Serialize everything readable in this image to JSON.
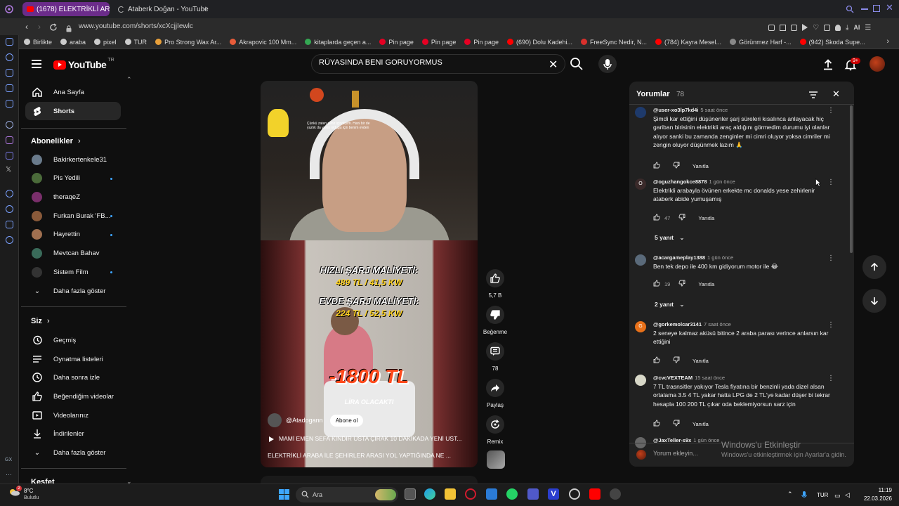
{
  "browser": {
    "tabs": [
      {
        "label": "(1678) ELEKTRİKLİ ARA"
      },
      {
        "label": "Ataberk Doğan - YouTube"
      }
    ],
    "url": "www.youtube.com/shorts/xcXcjjIewlc",
    "bookmarks": [
      {
        "label": "Birlikte",
        "color": "#cccccc"
      },
      {
        "label": "araba",
        "color": "#cccccc"
      },
      {
        "label": "pixel",
        "color": "#cccccc"
      },
      {
        "label": "TUR",
        "color": "#cccccc"
      },
      {
        "label": "Pro Strong Wax Ar...",
        "color": "#e8a03a"
      },
      {
        "label": "Akrapovic 100 Mm...",
        "color": "#e85c3a"
      },
      {
        "label": "kitaplarda geçen a...",
        "color": "#34a853"
      },
      {
        "label": "Pin page",
        "color": "#e60023"
      },
      {
        "label": "Pin page",
        "color": "#e60023"
      },
      {
        "label": "Pin page",
        "color": "#e60023"
      },
      {
        "label": "(690) Dolu Kadehi...",
        "color": "#ff0000"
      },
      {
        "label": "FreeSync Nedir, N...",
        "color": "#d9302c"
      },
      {
        "label": "(784) Kayra Mesel...",
        "color": "#ff0000"
      },
      {
        "label": "Görünmez Harf -...",
        "color": "#888888"
      },
      {
        "label": "(942) Skoda Supe...",
        "color": "#ff0000"
      }
    ],
    "extension_label": "AI"
  },
  "header": {
    "logo_text": "YouTube",
    "logo_region": "TR",
    "search_value": "RÜYASINDA BENI GORUYORMUS",
    "notif_badge": "9+"
  },
  "sidebar": {
    "main": [
      {
        "label": "Ana Sayfa"
      },
      {
        "label": "Shorts"
      }
    ],
    "subscriptions_title": "Abonelikler",
    "subscriptions": [
      {
        "label": "Bakirkertenkele31",
        "color": "#6a7b8c",
        "dot": false
      },
      {
        "label": "Pis Yedili",
        "color": "#4b6b3a",
        "dot": true
      },
      {
        "label": "theraqeZ",
        "color": "#7a2f6b",
        "dot": false
      },
      {
        "label": "Furkan Burak 'FB...",
        "color": "#8a5a3a",
        "dot": true
      },
      {
        "label": "Hayrettin",
        "color": "#a07050",
        "dot": true
      },
      {
        "label": "Mevtcan Bahav",
        "color": "#3a6b5a",
        "dot": false
      },
      {
        "label": "Sistem Film",
        "color": "#333333",
        "dot": true
      }
    ],
    "show_more": "Daha fazla göster",
    "you_title": "Siz",
    "you_items": [
      {
        "label": "Geçmiş"
      },
      {
        "label": "Oynatma listeleri"
      },
      {
        "label": "Daha sonra izle"
      },
      {
        "label": "Beğendiğim videolar"
      },
      {
        "label": "Videolarınız"
      },
      {
        "label": "İndirilenler"
      }
    ],
    "show_more_2": "Daha fazla göster",
    "explore_title": "Keşfet"
  },
  "video": {
    "overlay_small": "Çünkü zaten şehir içindeyim. Hani bir de yazlık da yakın olduğu için benim evden",
    "line1": "HIZLI ŞARJ MALİYETİ:",
    "line2": "489 TL  / 41,5 KW",
    "line3": "EVDE ŞARJ MALİYETİ:",
    "line4": "224 TL / 52,5 KW",
    "big_number": "-1800 TL",
    "lira": "LİRA OLACAKTI",
    "channel": "@Atadogann",
    "subscribe": "Abone ol",
    "title": "MAMİ EMEN SEFA KINDIR USTA ÇIRAK 10 DAKİKADA YENİ UST...",
    "description": "ELEKTRİKLİ ARABA İLE ŞEHİRLER ARASI YOL YAPTIĞINDA NE ..."
  },
  "actions": {
    "likes": "5,7 B",
    "dislike": "Beğenme",
    "comments": "78",
    "share": "Paylaş",
    "remix": "Remix"
  },
  "comments": {
    "title": "Yorumlar",
    "count": "78",
    "items": [
      {
        "user": "@user-xo3lp7kd4i",
        "time": "5 saat önce",
        "text": "Şimdi kar ettiğini düşünenler şarj süreleri kısalınca anlayacak hiç gariban birisinin elektrikli araç aldığını görmedim durumu iyi olanlar alıyor sanki bu zamanda zenginler mi cimri oluyor yoksa cimriler mi zengin oluyor düşünmek lazım 🙏",
        "likes": "",
        "reply": "Yanıtla",
        "avatar_color": "#1e3a6b",
        "avatar_letter": ""
      },
      {
        "user": "@oguzhangokce8878",
        "time": "1 gün önce",
        "text": "Elektrikli arabayla övünen erkekte mc donalds yese zehirlenir ataberk abide yumuşamış",
        "likes": "47",
        "reply": "Yanıtla",
        "avatar_color": "#3a2a2a",
        "avatar_letter": "O"
      },
      {
        "user": "@acargameplay1388",
        "time": "1 gün önce",
        "text": "Ben tek depo ile 400 km gidiyorum motor ile 😂",
        "likes": "19",
        "reply": "Yanıtla",
        "avatar_color": "#5a6a7a",
        "avatar_letter": ""
      },
      {
        "user": "@gorkemolcar3141",
        "time": "7 saat önce",
        "text": "2 seneye kalmaz aküsü bitince 2 araba parası verince anlarsın kar ettiğini",
        "likes": "",
        "reply": "Yanıtla",
        "avatar_color": "#e8711a",
        "avatar_letter": "G"
      },
      {
        "user": "@cvcVEXTEAM",
        "time": "15 saat önce",
        "text": "7 TL trasnsitler yakıyor Tesla fiyatına bir benzinli yada dizel alsan ortalama 3.5 4 TL yakar hatta LPG de 2 TL'ye kadar düşer bi tekrar hesapla  100 200 TL çıkar oda beklemiyorsun sarz için",
        "likes": "",
        "reply": "Yanıtla",
        "avatar_color": "#d8d8c8",
        "avatar_letter": ""
      },
      {
        "user": "@JaxTeller-s9x",
        "time": "1 gün önce",
        "text": "",
        "likes": "",
        "reply": "",
        "avatar_color": "#666666",
        "avatar_letter": ""
      }
    ],
    "replies_1": "5 yanıt",
    "replies_2": "2 yanıt",
    "input_placeholder": "Yorum ekleyin..."
  },
  "watermark": {
    "title": "Windows'u Etkinleştir",
    "subtitle": "Windows'u etkinleştirmek için Ayarlar'a gidin."
  },
  "taskbar": {
    "weather_temp": "8°C",
    "weather_desc": "Bulutlu",
    "weather_badge": "2",
    "search": "Ara",
    "lang": "TUR",
    "time": "11:19",
    "date": "22.03.2026"
  }
}
